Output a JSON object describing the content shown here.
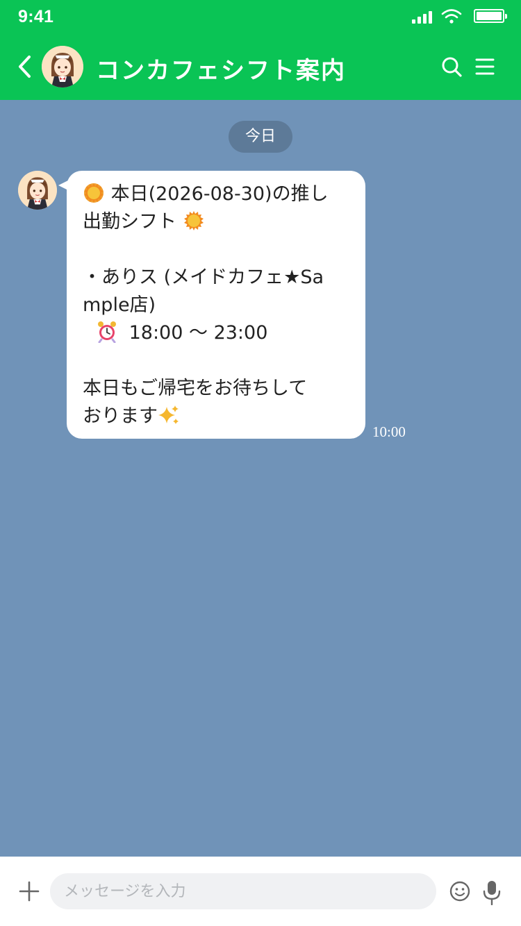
{
  "status_bar": {
    "time": "9:41"
  },
  "header": {
    "title": "コンカフェシフト案内",
    "icons": [
      "back-icon",
      "avatar",
      "search-icon",
      "menu-icon"
    ],
    "accent": "#0ac455"
  },
  "chat": {
    "date_separator": "今日",
    "background": "#7093b8",
    "message": {
      "line_1": "本日(2026-08-30)の推し",
      "line_2": "出勤シフト",
      "line_3": "・ありス (メイドカフェ★Sa",
      "line_4": "mple店)",
      "line_5": "18:00 〜 23:00",
      "line_6": "本日もご帰宅をお待ちして",
      "line_7": "おります",
      "time": "10:00",
      "icons": [
        "sun-icon",
        "alarm-clock-icon",
        "sparkles-icon"
      ]
    }
  },
  "footer": {
    "input_placeholder": "メッセージを入力",
    "icons": [
      "plus-icon",
      "emoji-icon",
      "mic-icon"
    ]
  }
}
